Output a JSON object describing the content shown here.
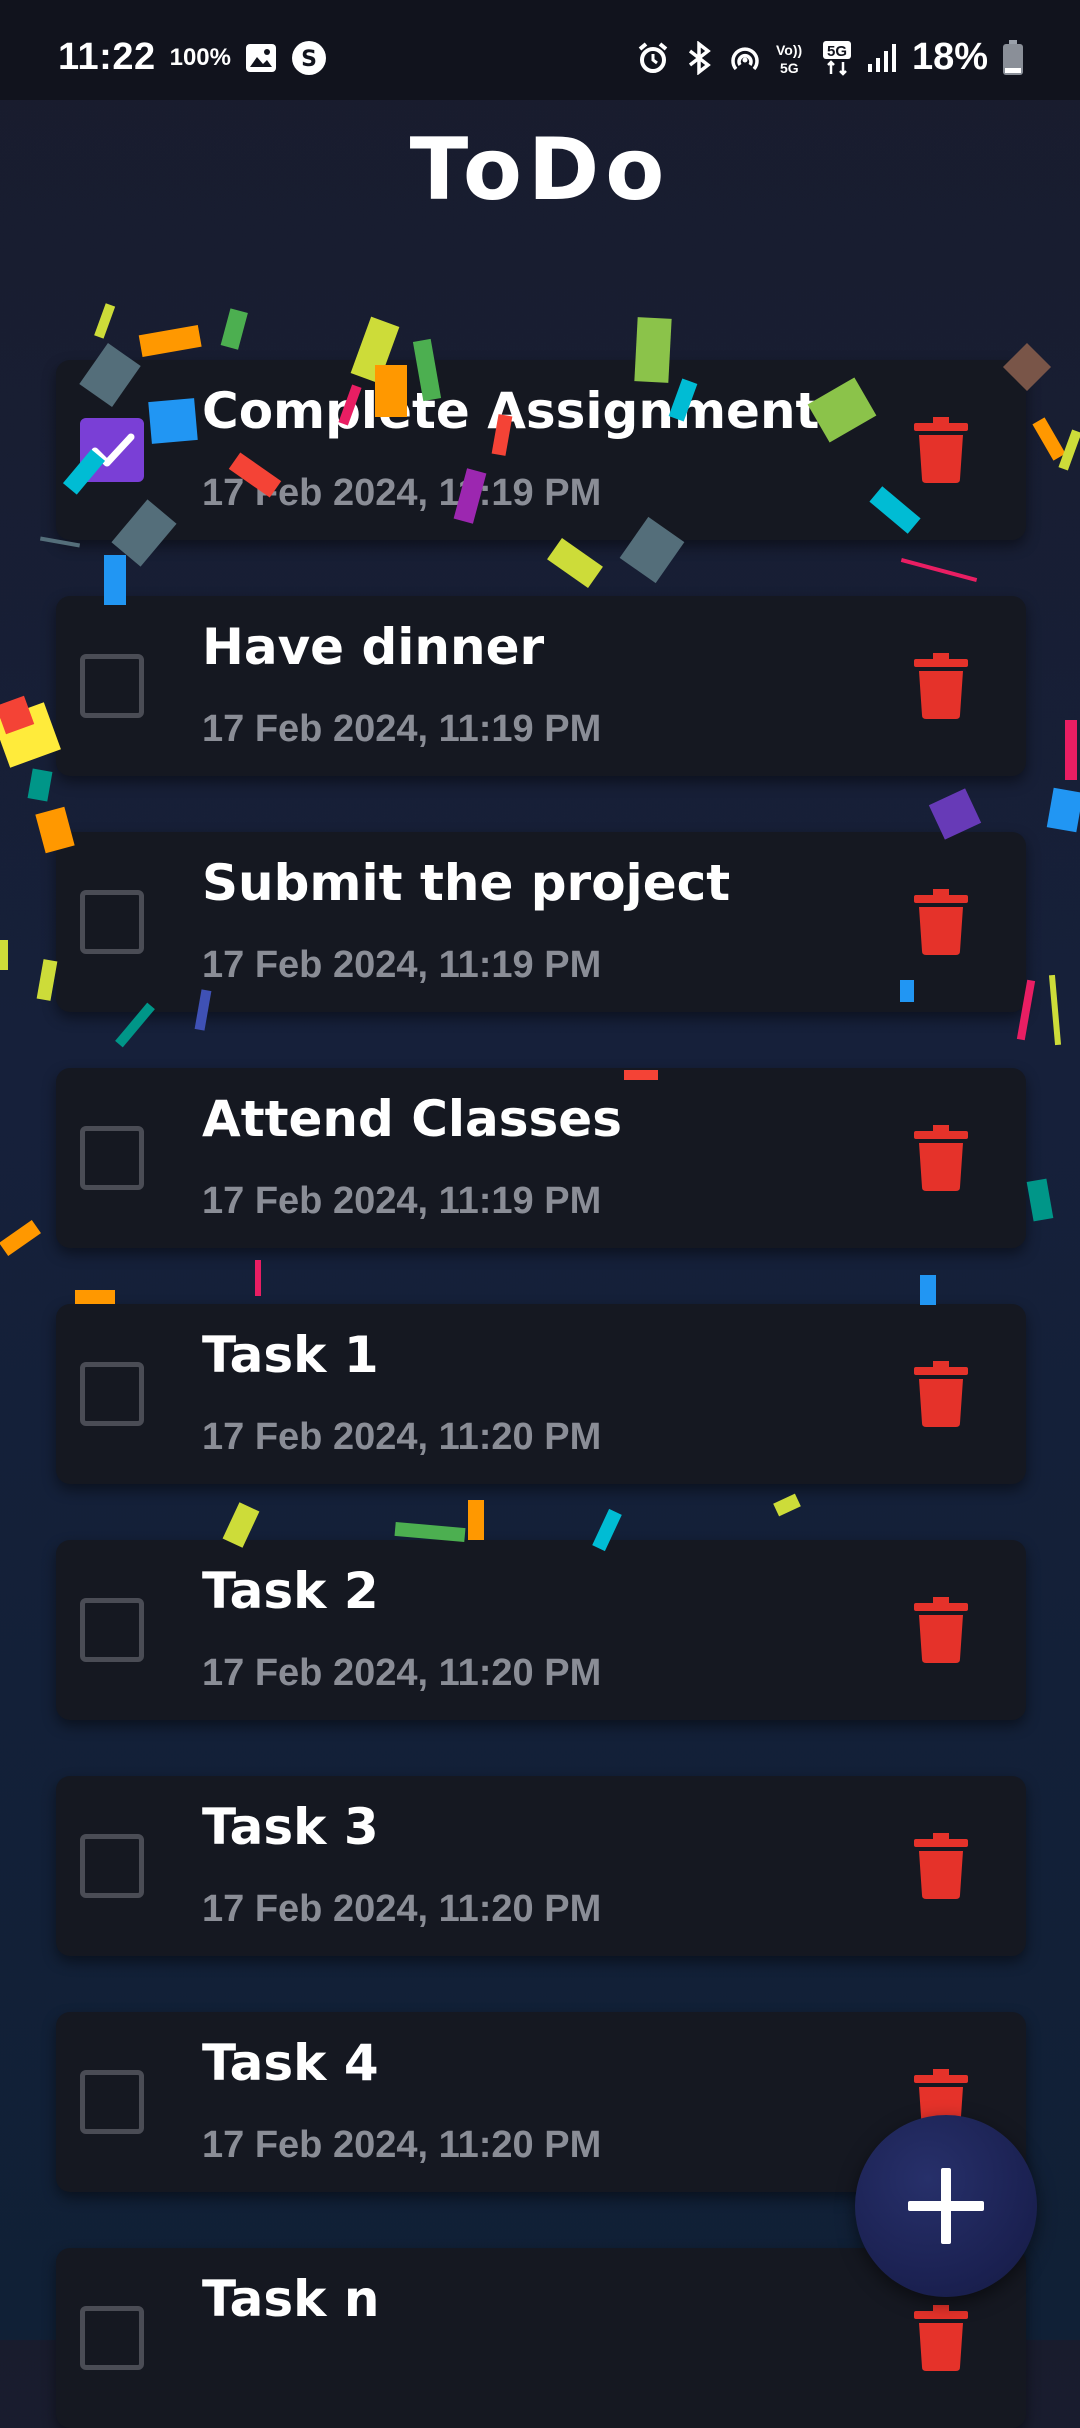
{
  "status_bar": {
    "time": "11:22",
    "indicator_text": "100%",
    "battery_text": "18%",
    "icons": [
      "gallery-icon",
      "s-app-icon",
      "alarm-icon",
      "bluetooth-icon",
      "hotspot-icon",
      "volte-icon",
      "5g-icon",
      "signal-icon",
      "battery-icon"
    ]
  },
  "app": {
    "title": "ToDo",
    "accent_color": "#7a3fd6",
    "delete_color": "#e5322a"
  },
  "tasks": [
    {
      "title": "Complete Assignment",
      "time": "17 Feb 2024, 11:19 PM",
      "checked": true
    },
    {
      "title": "Have dinner",
      "time": "17 Feb 2024, 11:19 PM",
      "checked": false
    },
    {
      "title": "Submit the project",
      "time": "17 Feb 2024, 11:19 PM",
      "checked": false
    },
    {
      "title": "Attend Classes",
      "time": "17 Feb 2024, 11:19 PM",
      "checked": false
    },
    {
      "title": "Task 1",
      "time": "17 Feb 2024, 11:20 PM",
      "checked": false
    },
    {
      "title": "Task 2",
      "time": "17 Feb 2024, 11:20 PM",
      "checked": false
    },
    {
      "title": "Task 3",
      "time": "17 Feb 2024, 11:20 PM",
      "checked": false
    },
    {
      "title": "Task 4",
      "time": "17 Feb 2024, 11:20 PM",
      "checked": false
    },
    {
      "title": "Task n",
      "time": "",
      "checked": false
    }
  ],
  "fab": {
    "icon": "plus-icon"
  }
}
